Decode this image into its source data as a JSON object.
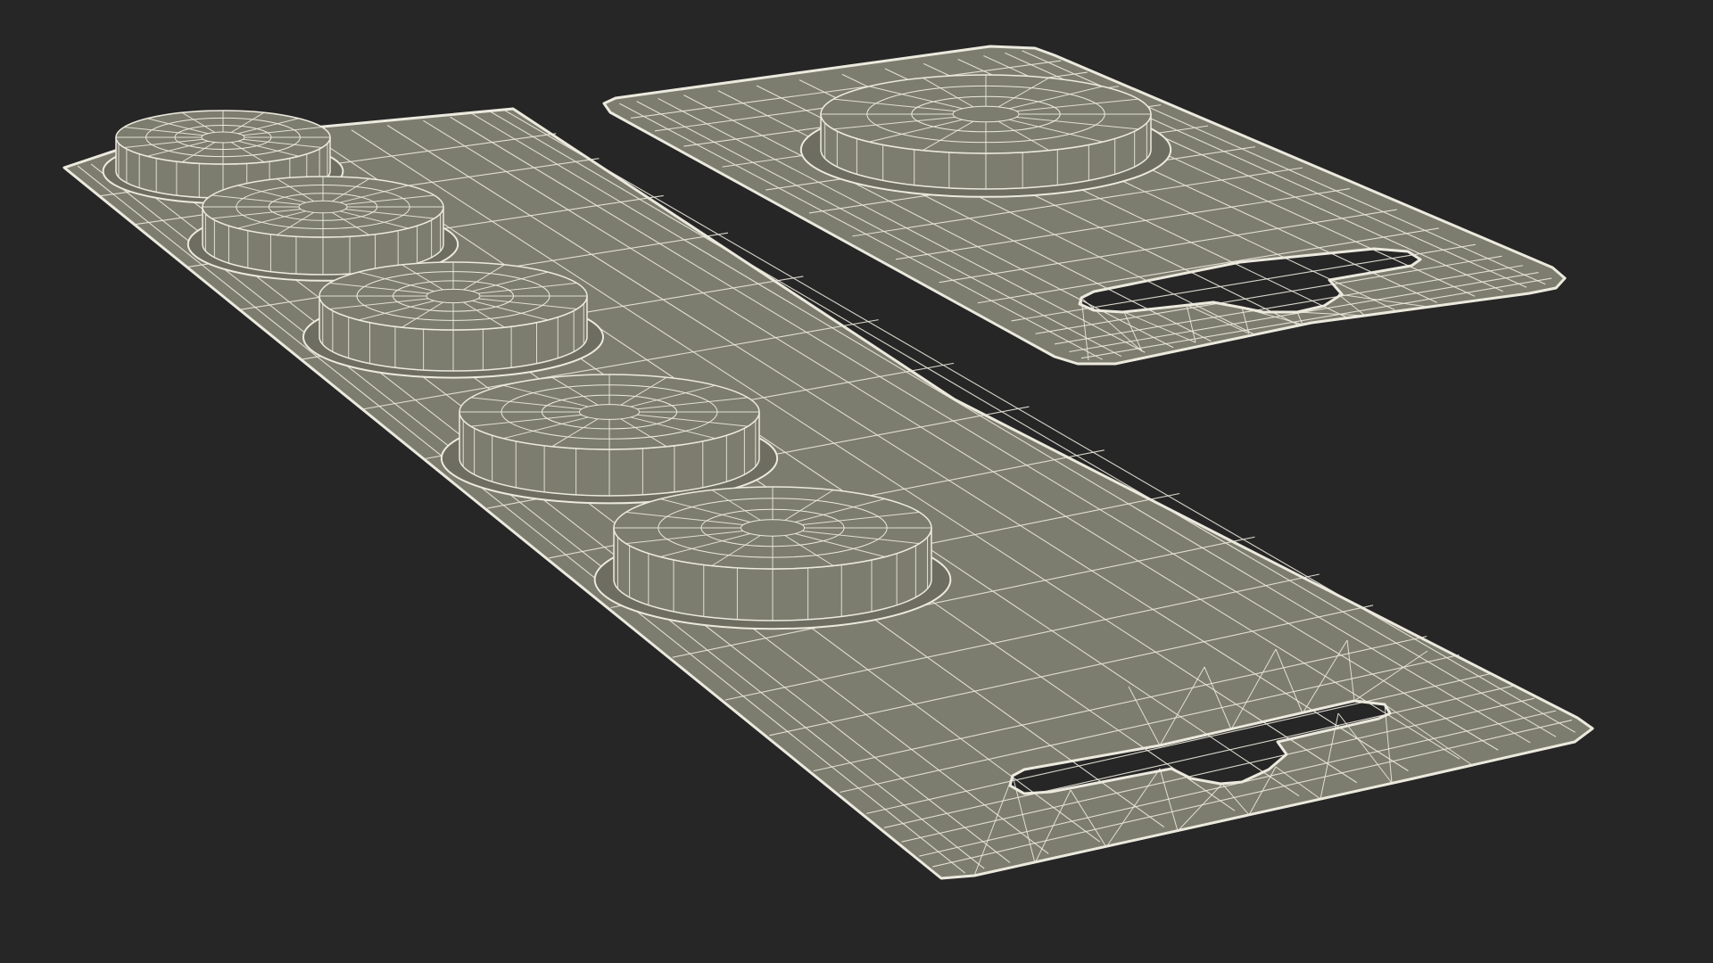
{
  "scene": {
    "background": "#262626",
    "surface_color": "#7c7c6f",
    "surface_shade": "#6d6d61",
    "wire_color": "#eceade",
    "objects": [
      {
        "name": "blister-card-five-cavity",
        "cavities": 5,
        "hang_hole": true
      },
      {
        "name": "blister-card-single-cavity",
        "cavities": 1,
        "hang_hole": true
      }
    ]
  }
}
